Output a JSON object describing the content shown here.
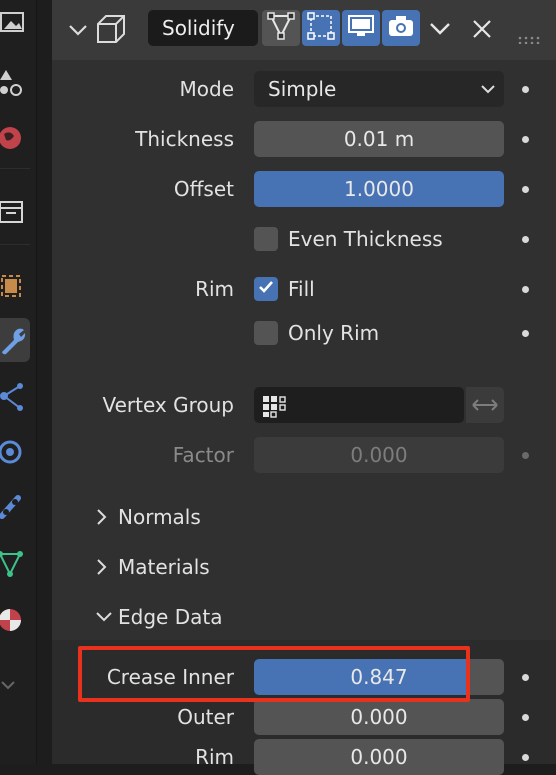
{
  "modifier": {
    "name": "Solidify",
    "toggles": [
      {
        "name": "edit-mode-icon",
        "active": false
      },
      {
        "name": "on-cage-icon",
        "active": true
      },
      {
        "name": "realtime-display-icon",
        "active": true
      },
      {
        "name": "render-camera-icon",
        "active": true
      }
    ]
  },
  "properties": {
    "mode": {
      "label": "Mode",
      "value": "Simple"
    },
    "thickness": {
      "label": "Thickness",
      "value": "0.01 m"
    },
    "offset": {
      "label": "Offset",
      "value": "1.0000",
      "fraction": 1.0
    },
    "even_thickness": {
      "label": "Even Thickness",
      "checked": false
    },
    "rim": {
      "label": "Rim"
    },
    "fill": {
      "label": "Fill",
      "checked": true
    },
    "only_rim": {
      "label": "Only Rim",
      "checked": false
    },
    "vertex_group": {
      "label": "Vertex Group",
      "value": ""
    },
    "factor": {
      "label": "Factor",
      "value": "0.000"
    }
  },
  "subpanels": {
    "normals": "Normals",
    "materials": "Materials",
    "edge_data": "Edge Data"
  },
  "edge_data": {
    "crease_inner": {
      "label": "Crease Inner",
      "value": "0.847",
      "fraction": 0.847
    },
    "outer": {
      "label": "Outer",
      "value": "0.000"
    },
    "rim": {
      "label": "Rim",
      "value": "0.000"
    }
  },
  "colors": {
    "accent": "#4772b3",
    "highlight": "#e8321e"
  }
}
